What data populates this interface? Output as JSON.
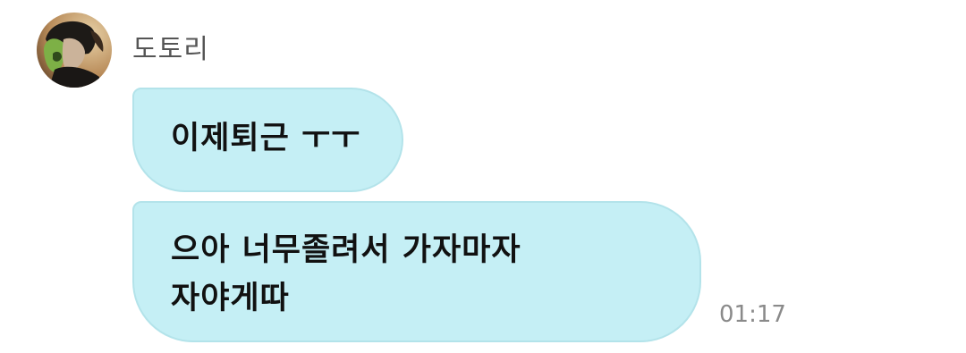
{
  "sender": {
    "name": "도토리",
    "avatar_icon": "profile-avatar"
  },
  "messages": [
    {
      "lines": [
        "이제퇴근 ㅜㅜ"
      ]
    },
    {
      "lines": [
        "으아 너무졸려서 가자마자",
        "자야게따"
      ],
      "time": "01:17"
    }
  ],
  "colors": {
    "bubble_bg": "#c5eff5",
    "bubble_border": "#b3e3ea",
    "name_text": "#555555",
    "time_text": "#8a8a8a"
  }
}
